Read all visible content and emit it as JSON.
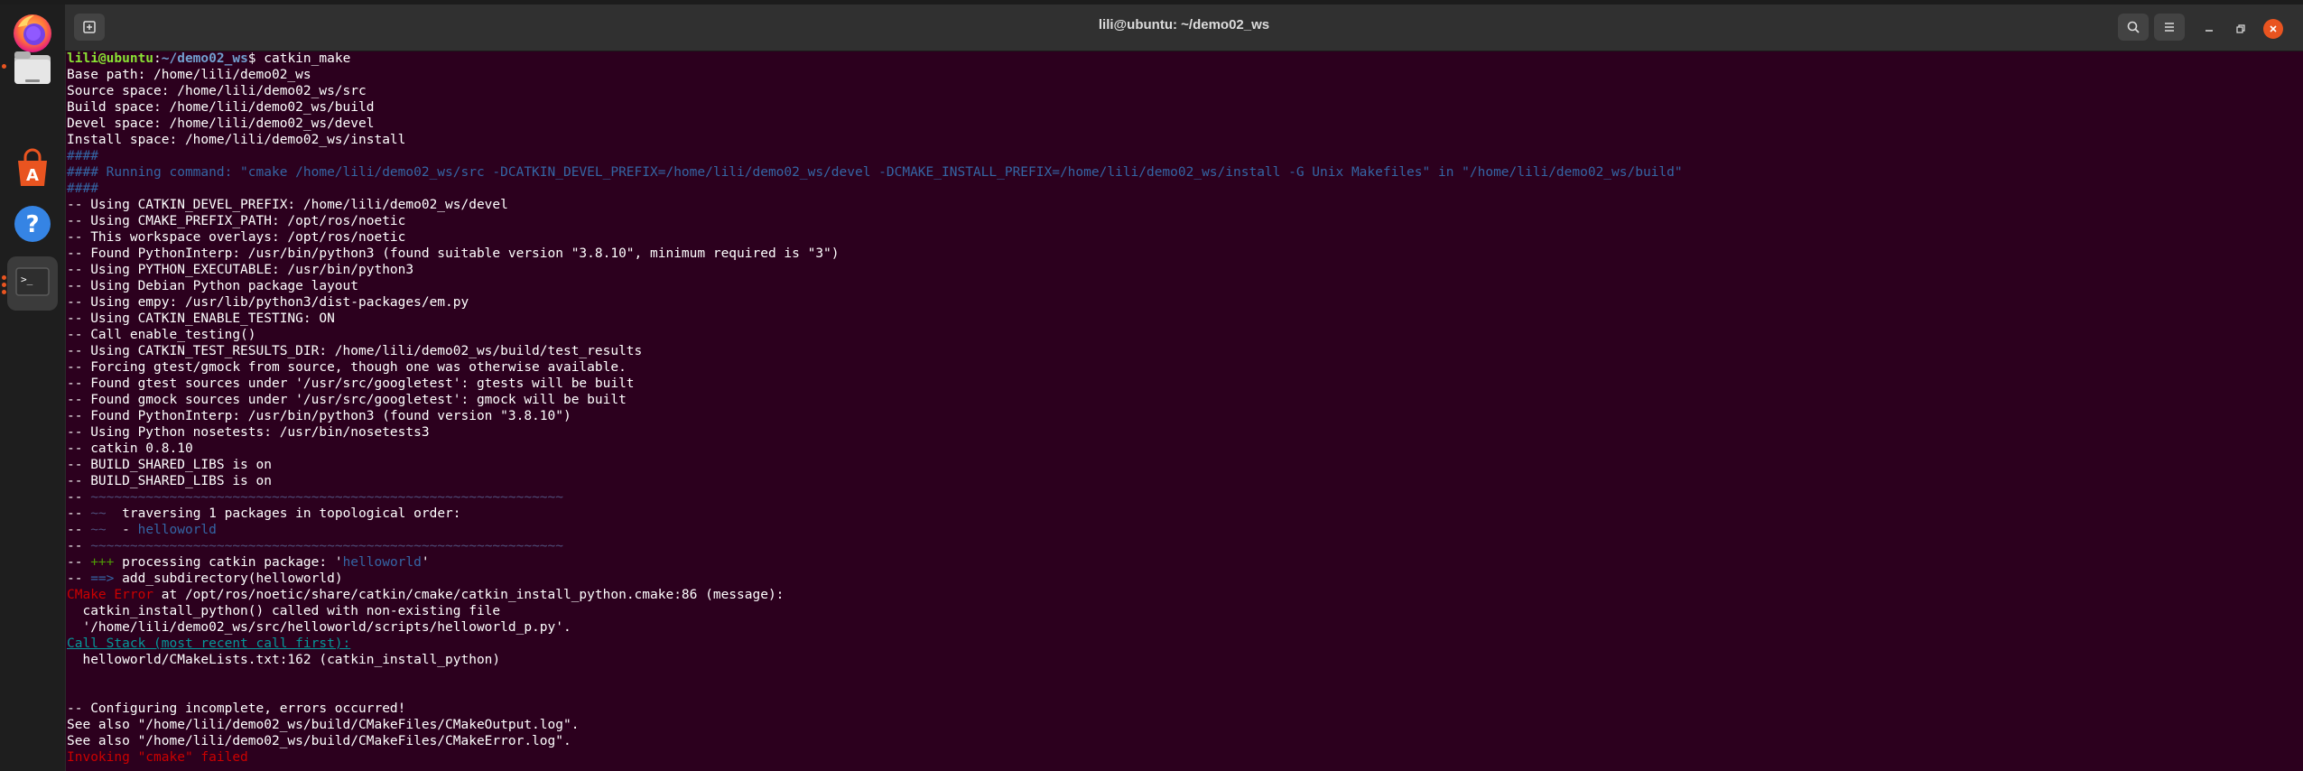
{
  "window": {
    "title": "lili@ubuntu: ~/demo02_ws"
  },
  "dock": {
    "items": [
      {
        "name": "Firefox",
        "icon": "firefox-icon"
      },
      {
        "name": "Files",
        "icon": "files-icon"
      },
      {
        "name": "Ubuntu Software",
        "icon": "software-store-icon"
      },
      {
        "name": "Help",
        "icon": "help-icon"
      },
      {
        "name": "Terminal",
        "icon": "terminal-icon"
      }
    ]
  },
  "colors": {
    "terminal_bg": "#2c001e",
    "accent": "#e95420",
    "close_btn": "#e95420"
  },
  "terminal": {
    "prompt_user": "lili@ubuntu",
    "prompt_path": "~/demo02_ws",
    "command": "catkin_make",
    "base": [
      "Base path: /home/lili/demo02_ws",
      "Source space: /home/lili/demo02_ws/src",
      "Build space: /home/lili/demo02_ws/build",
      "Devel space: /home/lili/demo02_ws/devel",
      "Install space: /home/lili/demo02_ws/install"
    ],
    "hashes": "####",
    "running": "#### Running command: \"cmake /home/lili/demo02_ws/src -DCATKIN_DEVEL_PREFIX=/home/lili/demo02_ws/devel -DCMAKE_INSTALL_PREFIX=/home/lili/demo02_ws/install -G Unix Makefiles\" in \"/home/lili/demo02_ws/build\"",
    "log": [
      "-- Using CATKIN_DEVEL_PREFIX: /home/lili/demo02_ws/devel",
      "-- Using CMAKE_PREFIX_PATH: /opt/ros/noetic",
      "-- This workspace overlays: /opt/ros/noetic",
      "-- Found PythonInterp: /usr/bin/python3 (found suitable version \"3.8.10\", minimum required is \"3\")",
      "-- Using PYTHON_EXECUTABLE: /usr/bin/python3",
      "-- Using Debian Python package layout",
      "-- Using empy: /usr/lib/python3/dist-packages/em.py",
      "-- Using CATKIN_ENABLE_TESTING: ON",
      "-- Call enable_testing()",
      "-- Using CATKIN_TEST_RESULTS_DIR: /home/lili/demo02_ws/build/test_results",
      "-- Forcing gtest/gmock from source, though one was otherwise available.",
      "-- Found gtest sources under '/usr/src/googletest': gtests will be built",
      "-- Found gmock sources under '/usr/src/googletest': gmock will be built",
      "-- Found PythonInterp: /usr/bin/python3 (found version \"3.8.10\")",
      "-- Using Python nosetests: /usr/bin/nosetests3",
      "-- catkin 0.8.10",
      "-- BUILD_SHARED_LIBS is on",
      "-- BUILD_SHARED_LIBS is on"
    ],
    "dash": "-- ",
    "rule": "~~~~~~~~~~~~~~~~~~~~~~~~~~~~~~~~~~~~~~~~~~~~~~~~~~~~~~~~~~~~",
    "traverse_mark": "~~",
    "traverse_text": "  traversing 1 packages in topological order:",
    "pkg_mark": "~~",
    "pkg_bullet": "  - ",
    "pkg_name": "helloworld",
    "process_mark": "+++",
    "process_text": " processing catkin package: '",
    "process_pkg": "helloworld",
    "process_end": "'",
    "addsub_mark": "==>",
    "addsub_text": " add_subdirectory(helloworld)",
    "error_label": "CMake Error",
    "error_text": " at /opt/ros/noetic/share/catkin/cmake/catkin_install_python.cmake:86 (message):",
    "error_detail_1": "  catkin_install_python() called with non-existing file",
    "error_detail_2": "  '/home/lili/demo02_ws/src/helloworld/scripts/helloworld_p.py'.",
    "callstack_label": "Call Stack (most recent call first):",
    "callstack_line": "  helloworld/CMakeLists.txt:162 (catkin_install_python)",
    "tail": [
      "-- Configuring incomplete, errors occurred!",
      "See also \"/home/lili/demo02_ws/build/CMakeFiles/CMakeOutput.log\".",
      "See also \"/home/lili/demo02_ws/build/CMakeFiles/CMakeError.log\"."
    ],
    "failed": "Invoking \"cmake\" failed"
  }
}
